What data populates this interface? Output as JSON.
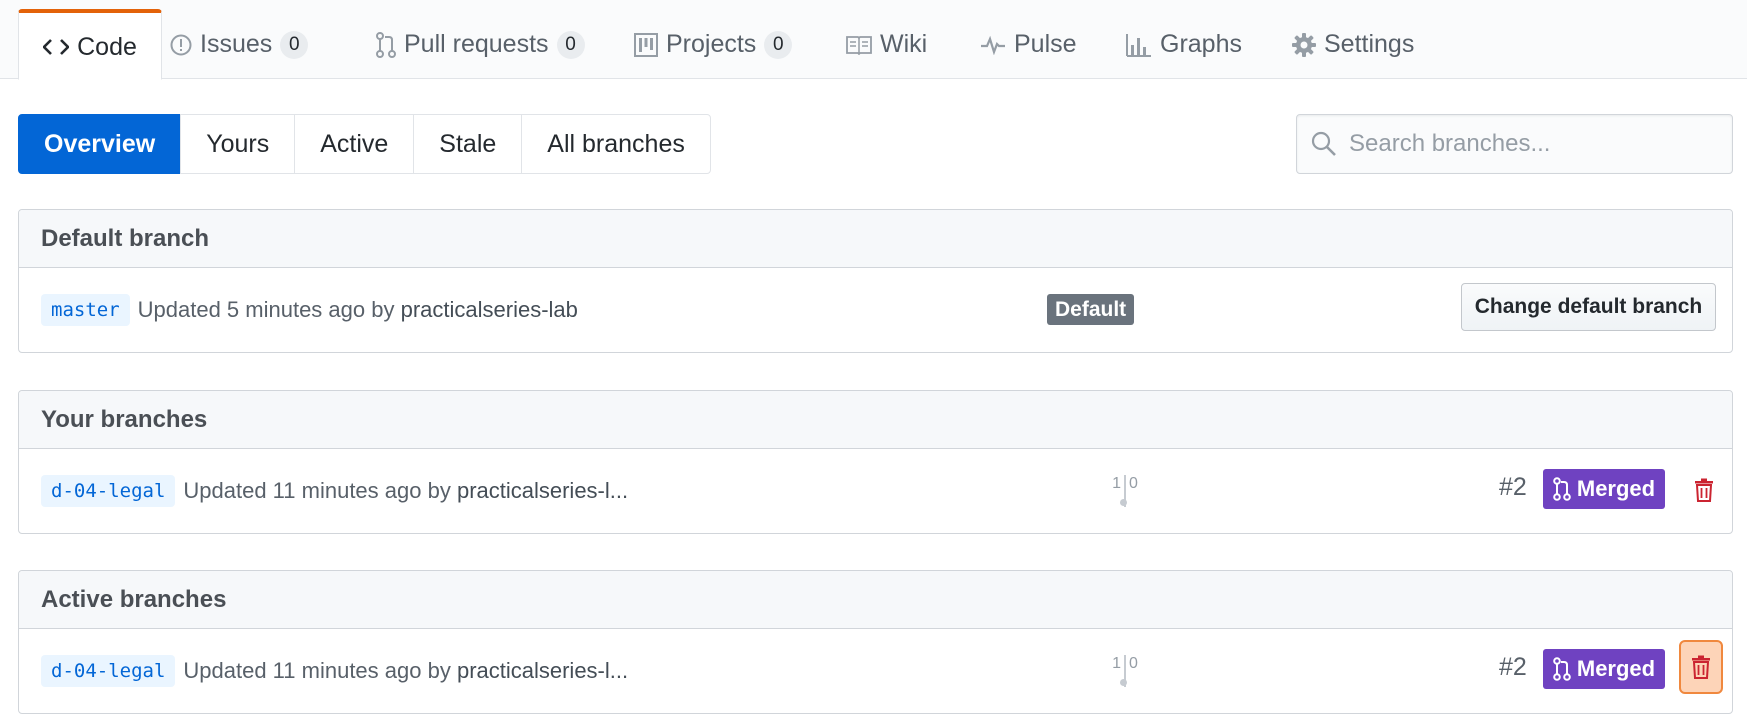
{
  "repo_nav": {
    "tabs": [
      {
        "label": "Code",
        "icon": "code-icon",
        "selected": true
      },
      {
        "label": "Issues",
        "icon": "issue-icon",
        "count": "0"
      },
      {
        "label": "Pull requests",
        "icon": "pull-request-icon",
        "count": "0"
      },
      {
        "label": "Projects",
        "icon": "project-icon",
        "count": "0"
      },
      {
        "label": "Wiki",
        "icon": "book-icon"
      },
      {
        "label": "Pulse",
        "icon": "pulse-icon"
      },
      {
        "label": "Graphs",
        "icon": "graph-icon"
      },
      {
        "label": "Settings",
        "icon": "gear-icon"
      }
    ],
    "accent_color": "#e36209"
  },
  "subnav": {
    "items": [
      "Overview",
      "Yours",
      "Active",
      "Stale",
      "All branches"
    ],
    "selected": "Overview",
    "selected_color": "#0366d6"
  },
  "search": {
    "placeholder": "Search branches..."
  },
  "default_branch": {
    "header": "Default branch",
    "branch": "master",
    "updated_prefix": "Updated 5 minutes ago by",
    "user": "practicalseries-lab",
    "label": "Default",
    "button": "Change default branch"
  },
  "your_branches": {
    "header": "Your branches",
    "rows": [
      {
        "branch": "d-04-legal",
        "updated_prefix": "Updated 11 minutes ago by",
        "user": "practicalseries-l...",
        "behind": "1",
        "ahead": "0",
        "pr": "#2",
        "status": "Merged",
        "status_color": "#6f42c1",
        "delete_icon": "trash-icon"
      }
    ]
  },
  "active_branches": {
    "header": "Active branches",
    "rows": [
      {
        "branch": "d-04-legal",
        "updated_prefix": "Updated 11 minutes ago by",
        "user": "practicalseries-l...",
        "behind": "1",
        "ahead": "0",
        "pr": "#2",
        "status": "Merged",
        "status_color": "#6f42c1",
        "delete_icon": "trash-icon"
      }
    ]
  }
}
